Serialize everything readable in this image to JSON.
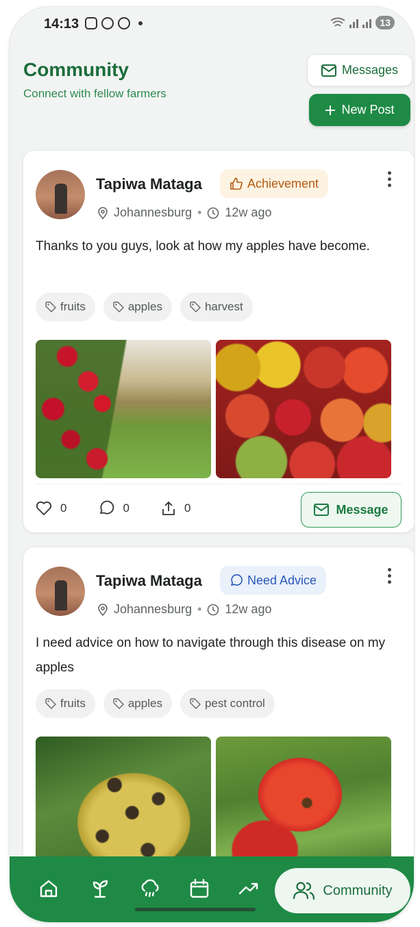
{
  "status_bar": {
    "time": "14:13",
    "battery": "13"
  },
  "header": {
    "title": "Community",
    "subtitle": "Connect with fellow farmers",
    "messages_label": "Messages",
    "new_post_label": "New Post"
  },
  "posts": [
    {
      "author": "Tapiwa Mataga",
      "badge": "Achievement",
      "location": "Johannesburg",
      "time_ago": "12w ago",
      "text": "Thanks to you guys, look at how my apples have become.",
      "tags": [
        "fruits",
        "apples",
        "harvest"
      ],
      "likes": "0",
      "comments": "0",
      "shares": "0",
      "message_label": "Message"
    },
    {
      "author": "Tapiwa Mataga",
      "badge": "Need Advice",
      "location": "Johannesburg",
      "time_ago": "12w ago",
      "text": "I need advice on how to navigate through this disease on my apples",
      "tags": [
        "fruits",
        "apples",
        "pest control"
      ]
    }
  ],
  "bottom_nav": {
    "items": [
      "home-icon",
      "sprout-icon",
      "weather-icon",
      "calendar-icon",
      "trend-icon"
    ],
    "active_label": "Community"
  },
  "colors": {
    "brand_green": "#1e8a45",
    "achievement": "#b45a11",
    "advice": "#2b58b8"
  }
}
